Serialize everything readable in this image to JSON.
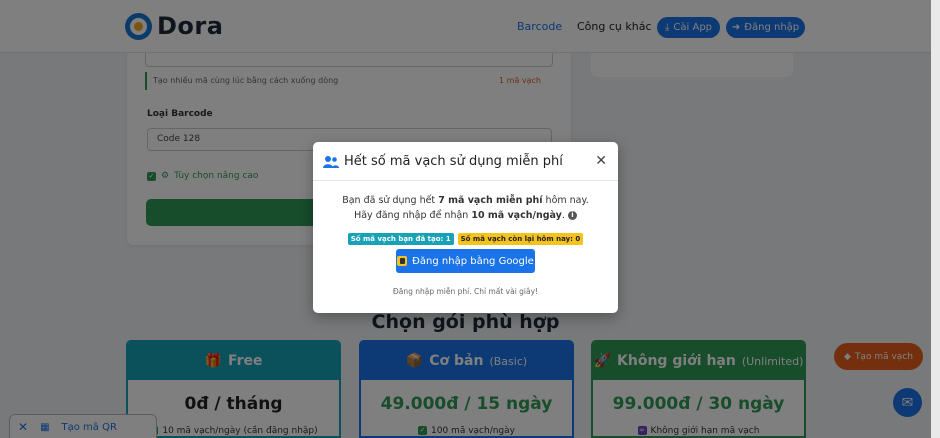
{
  "header": {
    "logo_text": "Dora",
    "nav": {
      "barcode": "Barcode",
      "tools": "Công cụ khác"
    },
    "install_label": "Cài App",
    "login_label": "Đăng nhập"
  },
  "form": {
    "hint": "Tạo nhiều mã cùng lúc bằng cách xuống dòng",
    "hint_count": "1 mã vạch",
    "type_label": "Loại Barcode",
    "type_value": "Code 128",
    "advanced_label": "Tùy chọn nâng cao"
  },
  "section": {
    "title": "Chọn gói phù hợp"
  },
  "plans": [
    {
      "name": "Free",
      "sub": "",
      "price": "0đ / tháng",
      "feature": "10 mã vạch/ngày (cần đăng nhập)"
    },
    {
      "name": "Cơ bản",
      "sub": "(Basic)",
      "price": "49.000đ / 15 ngày",
      "feature": "100 mã vạch/ngày"
    },
    {
      "name": "Không giới hạn",
      "sub": "(Unlimited)",
      "price": "99.000đ / 30 ngày",
      "feature": "Không giới hạn mã vạch"
    }
  ],
  "fab": {
    "create_label": "Tạo mã vạch"
  },
  "qr_tab": {
    "label": "Tạo mã QR"
  },
  "modal": {
    "title": "Hết số mã vạch sử dụng miễn phí",
    "line1_pre": "Bạn đã sử dụng hết ",
    "line1_bold": "7 mã vạch miễn phí",
    "line1_post": " hôm nay.",
    "line2_pre": "Hãy đăng nhập để nhận ",
    "line2_bold": "10 mã vạch/ngày",
    "line2_post": ".",
    "badge_created": "Số mã vạch bạn đã tạo: 1",
    "badge_remaining": "Số mã vạch còn lại hôm nay: 0",
    "google_label": "Đăng nhập bằng Google",
    "note": "Đăng nhập miễn phí. Chỉ mất vài giây!"
  },
  "colors": {
    "primary": "#1a73e8",
    "green": "#2e9b57",
    "teal": "#17a2b8",
    "orange": "#e8601c",
    "yellow": "#f5c31d"
  }
}
